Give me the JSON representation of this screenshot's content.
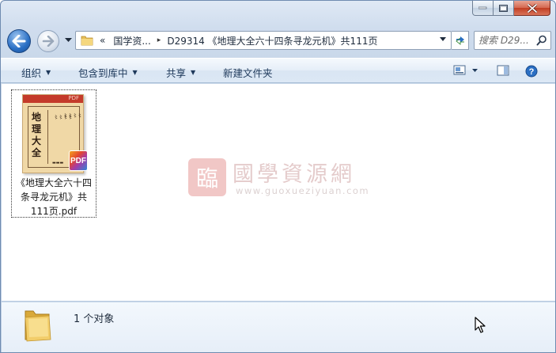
{
  "window": {
    "caption_buttons": [
      "minimize",
      "maximize",
      "close"
    ]
  },
  "nav": {
    "back_icon": "back-arrow-icon",
    "forward_icon": "forward-arrow-icon",
    "address": {
      "overflow": "«",
      "segment_1": "国学资...",
      "separator": "▸",
      "segment_2": "D29314 《地理大全六十四条寻龙元机》共111页"
    },
    "search": {
      "placeholder": "搜索 D29..."
    }
  },
  "toolbar": {
    "organize": "组织",
    "include_in_library": "包含到库中",
    "share": "共享",
    "new_folder": "新建文件夹"
  },
  "files": [
    {
      "name_line1": "《地理大全六十四",
      "name_line2": "条寻龙元机》共",
      "name_line3": "111页.pdf",
      "badge": "PDF",
      "thumb_title": "地理大全",
      "thumb_label": "PDF"
    }
  ],
  "watermark": {
    "seal": "臨",
    "chinese": "國學資源網",
    "url": "www.guoxueziyuan.com"
  },
  "status": {
    "count_text": "1 个对象"
  },
  "colors": {
    "accent": "#2a6fc4",
    "close": "#c13d22",
    "toolbar_text": "#1e395b"
  }
}
